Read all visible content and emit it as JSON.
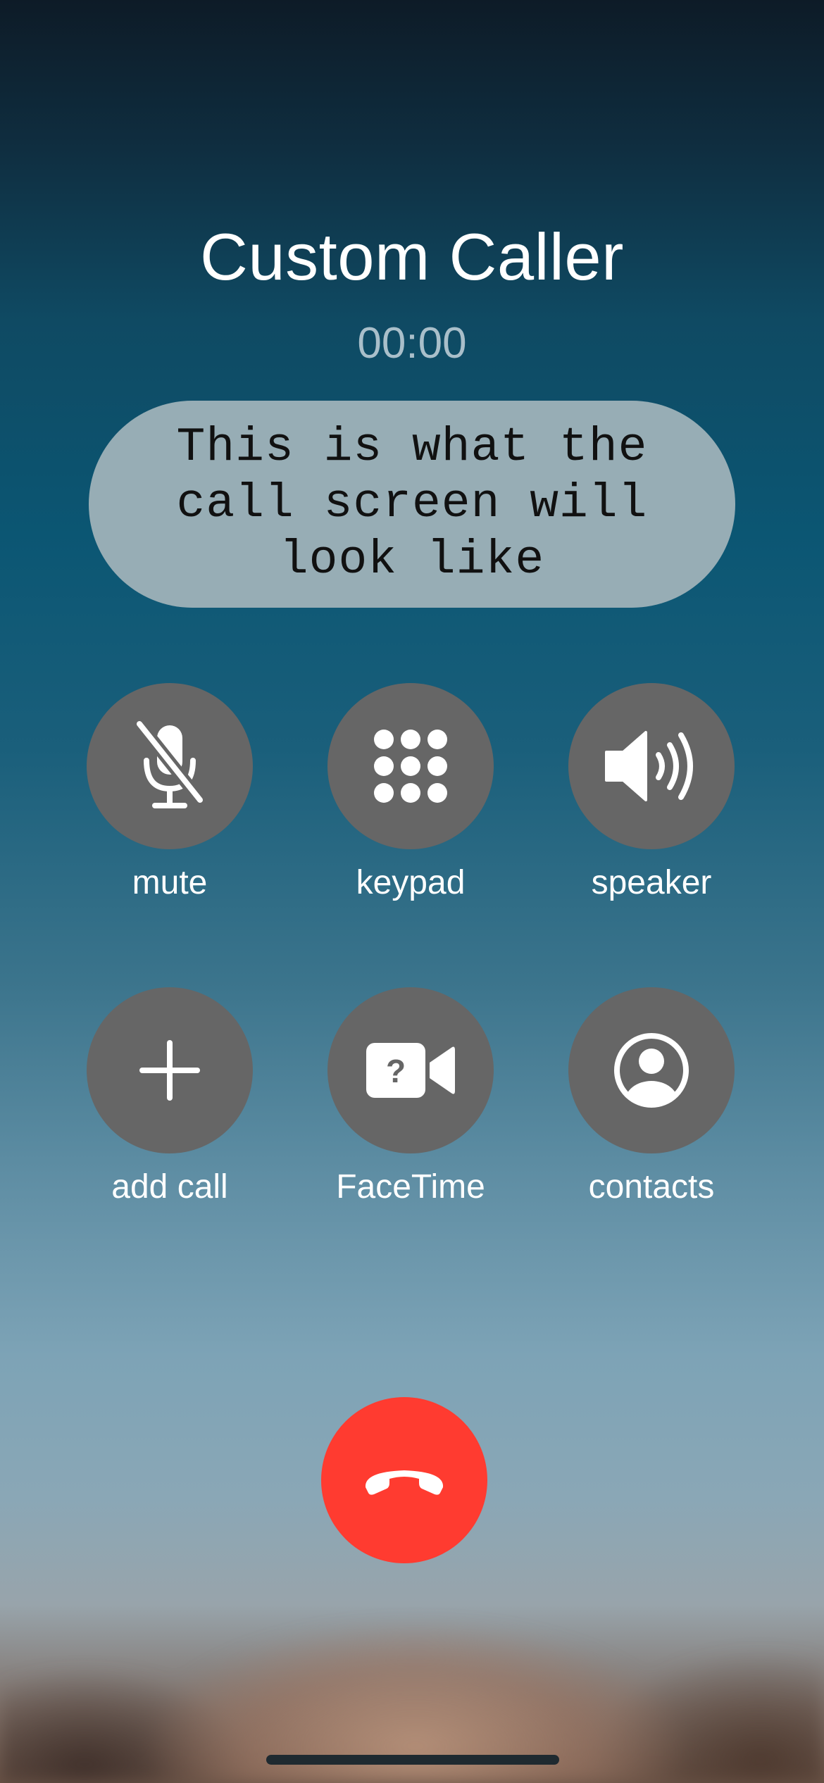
{
  "call": {
    "caller_name": "Custom Caller",
    "timer": "00:00",
    "message": "This is what the call screen will look like"
  },
  "controls": [
    {
      "label": "mute",
      "icon": "mic-slash-icon"
    },
    {
      "label": "keypad",
      "icon": "keypad-icon"
    },
    {
      "label": "speaker",
      "icon": "speaker-icon"
    },
    {
      "label": "add call",
      "icon": "plus-icon"
    },
    {
      "label": "FaceTime",
      "icon": "facetime-question-icon"
    },
    {
      "label": "contacts",
      "icon": "person-circle-icon"
    }
  ],
  "end_call": {
    "icon": "phone-hangup-icon",
    "color": "#ff3b30"
  },
  "colors": {
    "control_background": "#666666",
    "bubble_background": "#97adb5",
    "timer_text": "#a9bfca"
  }
}
